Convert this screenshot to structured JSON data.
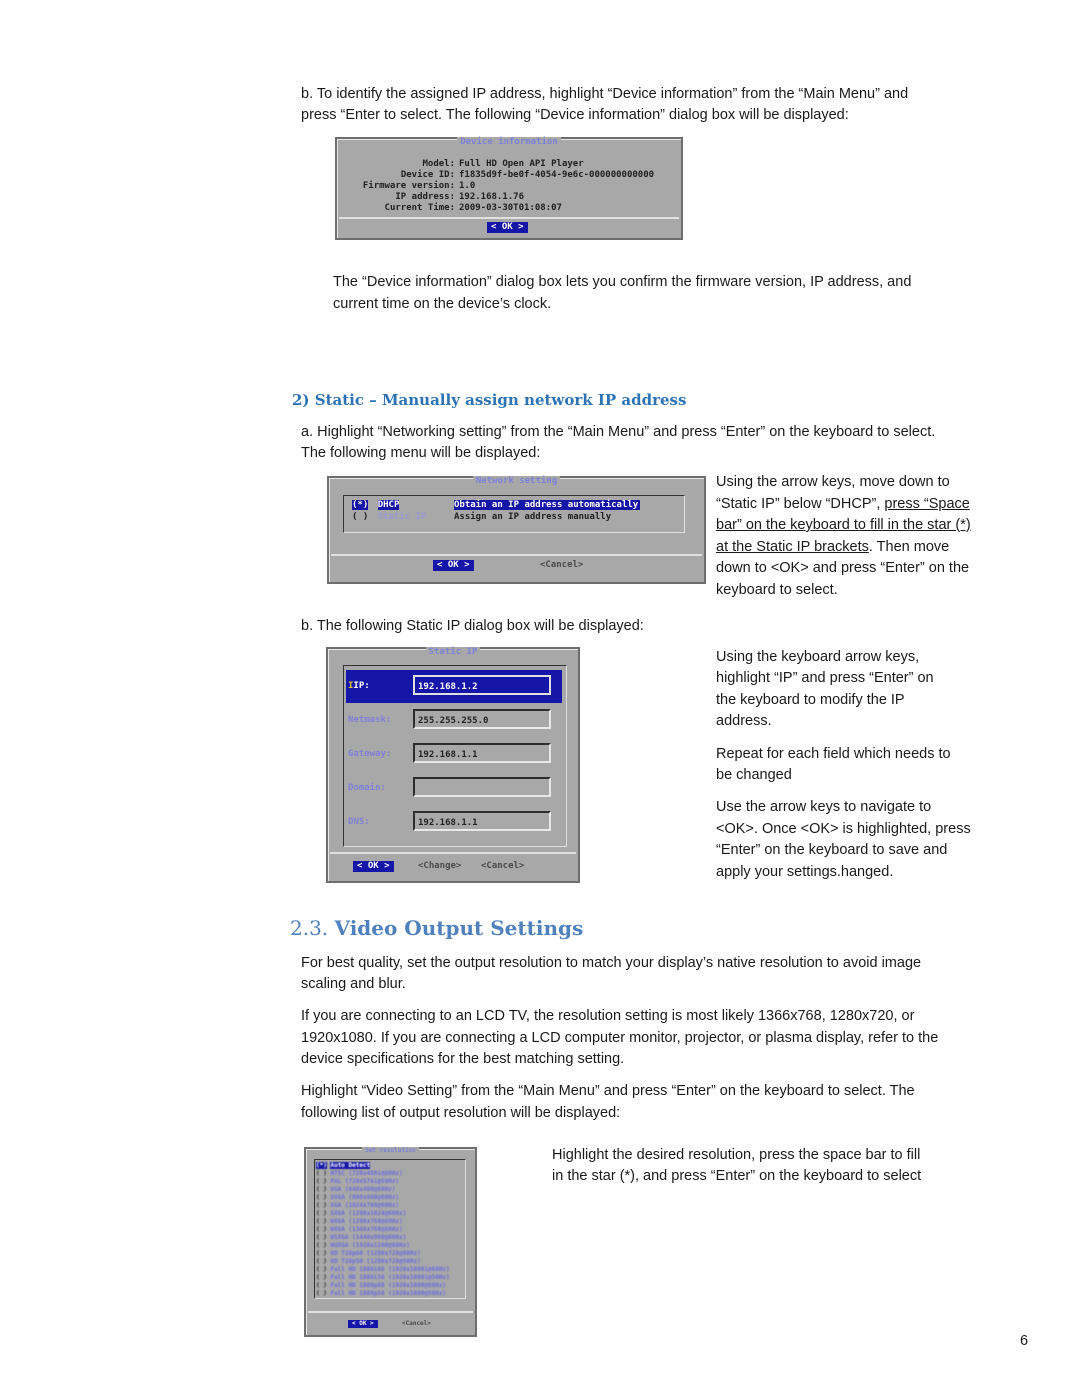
{
  "section1": {
    "step_b_line1": "b. To identify the assigned IP address, highlight “Device information” from the “Main Menu” and",
    "step_b_line2": "press “Enter to select.   The following “Device information” dialog box will be displayed:",
    "device_dialog": {
      "title": "Device information",
      "rows": [
        {
          "label": "Model:",
          "value": "Full HD Open API Player"
        },
        {
          "label": "Device ID:",
          "value": "f1835d9f-be0f-4054-9e6c-000000000000"
        },
        {
          "label": "Firmware version:",
          "value": "1.0"
        },
        {
          "label": "IP address:",
          "value": "192.168.1.76"
        },
        {
          "label": "Current Time:",
          "value": "2009-03-30T01:08:07"
        }
      ],
      "ok_label": "<  OK  >"
    },
    "note_line1": "The “Device information” dialog box lets you confirm the firmware version, IP address, and",
    "note_line2": "current time on the device’s clock."
  },
  "section2": {
    "heading": "2) Static – Manually assign network IP address",
    "step_a_line1": "a. Highlight “Networking setting” from the “Main Menu” and press “Enter” on the keyboard to select.",
    "step_a_line2": "The following menu will be displayed:",
    "network_dialog": {
      "title": "Network setting",
      "options": [
        {
          "radio": "(*)",
          "name": "DHCP",
          "desc": "Obtain an IP address automatically",
          "selected": true
        },
        {
          "radio": "( )",
          "name": "Static IP",
          "desc": "Assign an IP address manually",
          "selected": false
        }
      ],
      "ok_label": "<  OK  >",
      "cancel_label": "<Cancel>"
    },
    "side_note_a": {
      "l1": "Using the arrow keys, move down to",
      "l2_plain": "“Static IP” below “DHCP”, ",
      "l2_u": "press “Space",
      "l3_u": "bar” on the keyboard to fill in the star (*)",
      "l4_u": "at the Static IP brackets",
      "l4_plain": ". Then move",
      "l5": "down to <OK> and press “Enter” on the",
      "l6": "keyboard to select."
    },
    "step_b": "b. The following Static IP dialog box will be displayed:",
    "static_dialog": {
      "title": "Static IP",
      "fields": [
        {
          "label": "IP:",
          "value": "192.168.1.2"
        },
        {
          "label": "Netmask:",
          "value": "255.255.255.0"
        },
        {
          "label": "Gateway:",
          "value": "192.168.1.1"
        },
        {
          "label": "Domain:",
          "value": ""
        },
        {
          "label": "DNS:",
          "value": "192.168.1.1"
        }
      ],
      "ok_label": "<  OK  >",
      "change_label": "<Change>",
      "cancel_label": "<Cancel>"
    },
    "side_note_b": {
      "p1_l1": "Using the keyboard arrow keys,",
      "p1_l2": "highlight “IP” and press “Enter” on",
      "p1_l3": "the keyboard to modify the IP",
      "p1_l4": "address.",
      "p2_l1": "Repeat for each field which needs to",
      "p2_l2": "be changed",
      "p3_l1": "Use the arrow keys to navigate to",
      "p3_l2": "<OK>. Once <OK> is highlighted, press",
      "p3_l3": "“Enter” on the keyboard to save and",
      "p3_l4": "apply your settings.hanged."
    }
  },
  "section3": {
    "number": "2.3.",
    "heading": "Video Output Settings",
    "p1_l1": "For best quality, set the output resolution to match your display’s native resolution to avoid image",
    "p1_l2": "scaling and blur.",
    "p2_l1": "If you are connecting to an LCD TV, the resolution setting is most likely 1366x768, 1280x720, or",
    "p2_l2": "1920x1080. If you are connecting a LCD computer monitor, projector, or plasma display, refer to the",
    "p2_l3": "device specifications for the best matching setting.",
    "p3_l1": "Highlight “Video Setting” from the “Main Menu” and press “Enter” on the keyboard to select. The",
    "p3_l2": "following list of output resolution will be displayed:",
    "side_l1": "Highlight the desired resolution, press the space bar to fill",
    "side_l2": "in the star (*), and press “Enter” on the keyboard to select",
    "resolution_dialog": {
      "title": "Set resolution",
      "first_item": "Auto Detect",
      "items": [
        "NTSC (720x480i@60Hz)",
        "PAL (720x576i@50Hz)",
        "VGA (640x480@60Hz)",
        "SVGA (800x600@60Hz)",
        "XGA (1024x768@60Hz)",
        "SXGA (1280x1024@60Hz)",
        "WXGA (1280x768@60Hz)",
        "WXGA (1366x768@60Hz)",
        "WSXGA (1440x900@60Hz)",
        "WUXGA (1920x1200@60Hz)",
        "HD 720p60 (1280x720@60Hz)",
        "HD 720p50 (1280x720@50Hz)",
        "Full HD 1080i60 (1920x1080i@60Hz)",
        "Full HD 1080i50 (1920x1080i@50Hz)",
        "Full HD 1080p60 (1920x1080@60Hz)",
        "Full HD 1080p50 (1920x1080@50Hz)"
      ],
      "ok_label": "< OK >",
      "cancel_label": "<Cancel>"
    }
  },
  "footer": {
    "page_number": "6"
  }
}
